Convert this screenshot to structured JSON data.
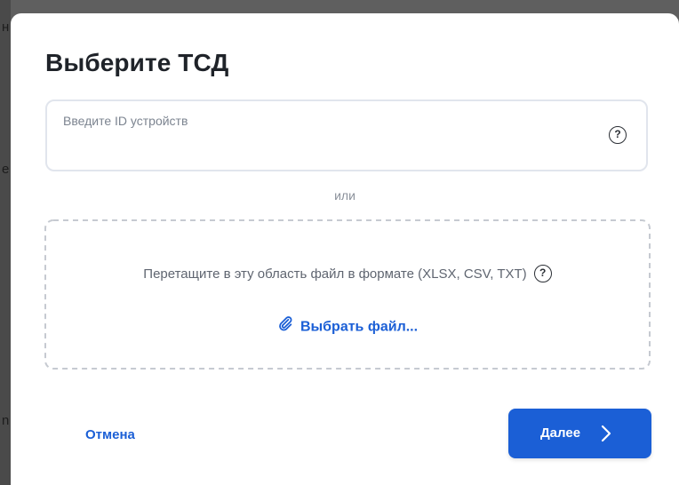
{
  "background": {
    "chars": [
      "н",
      "е",
      "n"
    ]
  },
  "modal": {
    "title": "Выберите ТСД",
    "id_input": {
      "value": "",
      "placeholder": "Введите ID устройств",
      "help_icon": "question-circle-icon",
      "help_glyph": "?"
    },
    "or_label": "или",
    "dropzone": {
      "text": "Перетащите в эту область файл в формате (XLSX, CSV, TXT)",
      "help_icon": "question-circle-icon",
      "help_glyph": "?",
      "choose_file_label": "Выбрать файл...",
      "choose_file_icon": "paperclip-icon"
    },
    "footer": {
      "cancel_label": "Отмена",
      "next_label": "Далее",
      "next_icon": "chevron-right-icon"
    }
  },
  "colors": {
    "accent": "#1b5fd6",
    "backdrop": "#5f5f5f",
    "text": "#1f2329",
    "muted": "#8b919b",
    "border": "#e1e5ed",
    "dash": "#c6cad1"
  }
}
